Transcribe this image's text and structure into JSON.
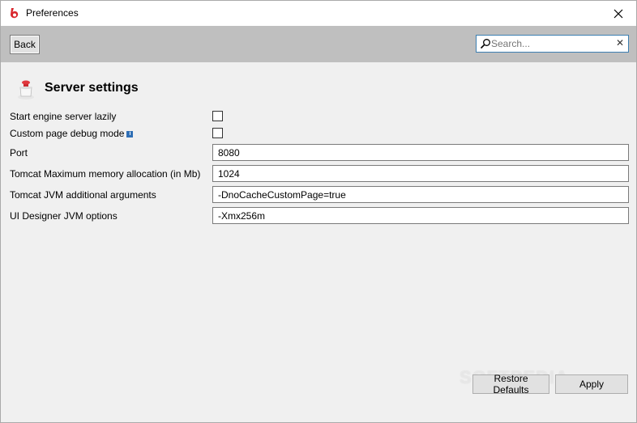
{
  "window": {
    "title": "Preferences"
  },
  "toolbar": {
    "back_label": "Back",
    "search_placeholder": "Search..."
  },
  "page": {
    "title": "Server settings"
  },
  "settings": {
    "lazy_label": "Start engine server lazily",
    "lazy_checked": false,
    "debug_label": "Custom page debug mode",
    "debug_checked": false,
    "port_label": "Port",
    "port_value": "8080",
    "memory_label": "Tomcat Maximum memory allocation (in Mb)",
    "memory_value": "1024",
    "jvm_args_label": "Tomcat JVM additional arguments",
    "jvm_args_value": "-DnoCacheCustomPage=true",
    "designer_label": "UI Designer JVM options",
    "designer_value": "-Xmx256m"
  },
  "footer": {
    "restore_label": "Restore Defaults",
    "apply_label": "Apply"
  },
  "watermark": "SOFTPEDIA",
  "colors": {
    "toolbar_bg": "#bfbfbf",
    "window_bg": "#f0f0f0",
    "accent": "#3c7fb1",
    "brand": "#d9262c"
  },
  "icons": {
    "app": "bonita-logo-icon",
    "search": "search-icon",
    "clear": "clear-icon",
    "header": "server-icon",
    "info": "info-icon",
    "close": "close-icon"
  }
}
